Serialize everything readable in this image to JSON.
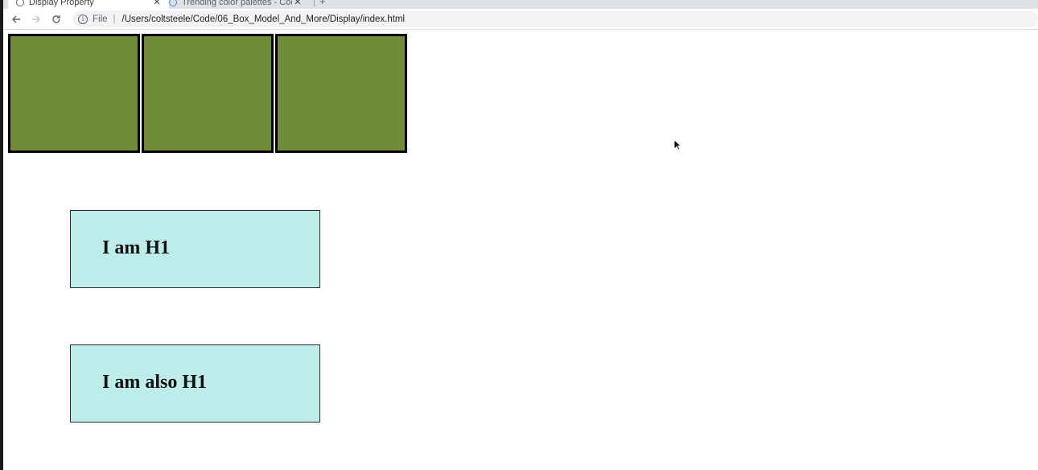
{
  "browser": {
    "tabs": [
      {
        "title": "Display Property",
        "active": true
      },
      {
        "title": "Trending color palettes - Coo",
        "active": false
      }
    ],
    "new_tab_symbol": "+",
    "close_symbol": "✕",
    "address": {
      "scheme_label": "File",
      "separator": "|",
      "url": "/Users/coltsteele/Code/06_Box_Model_And_More/Display/index.html"
    },
    "icons": {
      "back": "back-arrow-icon",
      "forward": "forward-arrow-icon",
      "reload": "reload-icon",
      "info": "info-icon"
    }
  },
  "page": {
    "green_boxes": [
      {
        "id": "box-1"
      },
      {
        "id": "box-2"
      },
      {
        "id": "box-3"
      }
    ],
    "headings": [
      {
        "text": "I am H1"
      },
      {
        "text": "I am also H1"
      }
    ]
  },
  "colors": {
    "green_box": "#718c36",
    "green_border": "#000000",
    "cyan_box": "#bdeceb"
  }
}
